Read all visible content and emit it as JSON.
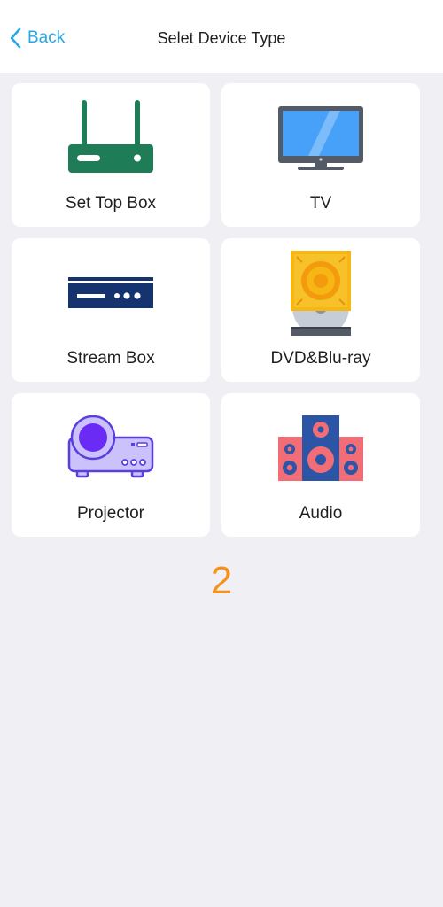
{
  "header": {
    "back_label": "Back",
    "title": "Selet Device Type",
    "accent_color": "#2aa7e3"
  },
  "devices": [
    {
      "label": "Set Top Box",
      "icon": "router-icon"
    },
    {
      "label": "TV",
      "icon": "tv-icon"
    },
    {
      "label": "Stream Box",
      "icon": "stream-box-icon"
    },
    {
      "label": "DVD&Blu-ray",
      "icon": "dvd-icon"
    },
    {
      "label": "Projector",
      "icon": "projector-icon"
    },
    {
      "label": "Audio",
      "icon": "speaker-icon"
    }
  ],
  "page_number": "2",
  "colors": {
    "background": "#efeff4",
    "card": "#ffffff",
    "page_number": "#f5921e"
  }
}
